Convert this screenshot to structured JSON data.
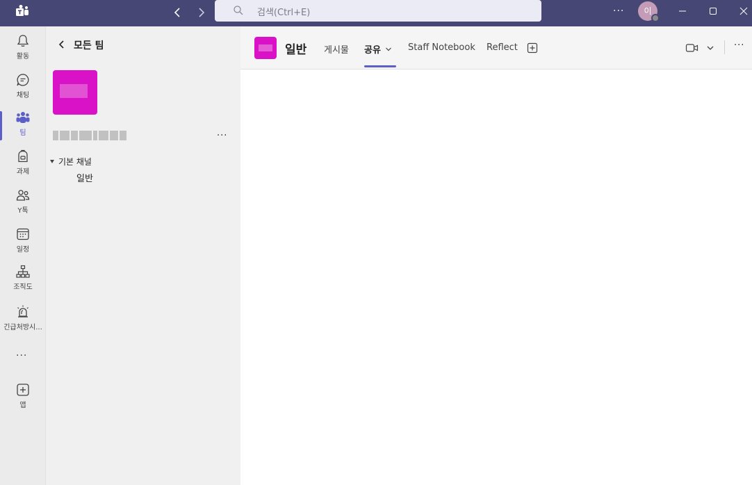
{
  "titlebar": {
    "search_placeholder": "검색(Ctrl+E)",
    "more": "···",
    "avatar_initials": "이"
  },
  "rail": {
    "items": [
      {
        "label": "활동",
        "icon": "bell-icon"
      },
      {
        "label": "채팅",
        "icon": "chat-icon"
      },
      {
        "label": "팀",
        "icon": "teams-icon",
        "active": true
      },
      {
        "label": "과제",
        "icon": "backpack-icon"
      },
      {
        "label": "Y톡",
        "icon": "people-icon"
      },
      {
        "label": "일정",
        "icon": "calendar-icon"
      },
      {
        "label": "조직도",
        "icon": "org-chart-icon"
      },
      {
        "label": "긴급처방시...",
        "icon": "siren-icon"
      },
      {
        "label": "앱",
        "icon": "add-app-icon"
      }
    ],
    "more": "···"
  },
  "teampane": {
    "back_label": "모든 팀",
    "team_more": "···",
    "section_label": "기본 채널",
    "channel": "일반"
  },
  "main": {
    "channel_title": "일반",
    "tabs": [
      {
        "label": "게시물"
      },
      {
        "label": "공유",
        "active": true
      },
      {
        "label": "Staff Notebook"
      },
      {
        "label": "Reflect"
      }
    ],
    "more": "···"
  },
  "colors": {
    "titlebar": "#464775",
    "accent": "#5b5fc7",
    "team_avatar": "#d911c7"
  }
}
